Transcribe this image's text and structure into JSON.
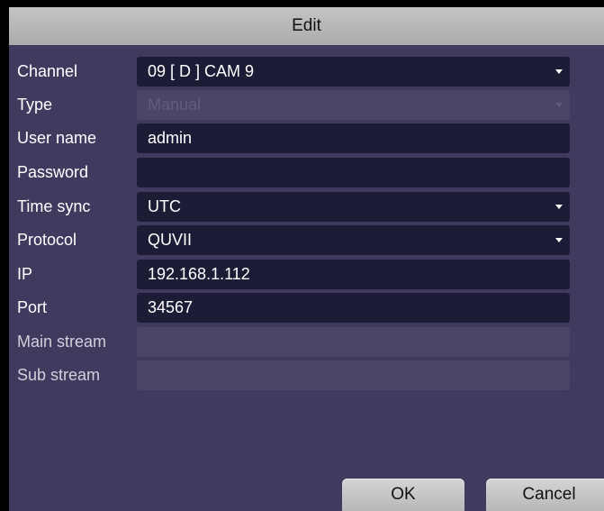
{
  "dialog": {
    "title": "Edit"
  },
  "fields": {
    "channel": {
      "label": "Channel",
      "value": "09 [ D ] CAM 9"
    },
    "type": {
      "label": "Type",
      "value": "Manual"
    },
    "user_name": {
      "label": "User name",
      "value": "admin"
    },
    "password": {
      "label": "Password",
      "value": ""
    },
    "time_sync": {
      "label": "Time sync",
      "value": "UTC"
    },
    "protocol": {
      "label": "Protocol",
      "value": "QUVII"
    },
    "ip": {
      "label": "IP",
      "value": "192.168.1.112"
    },
    "port": {
      "label": "Port",
      "value": "34567"
    },
    "main_stream": {
      "label": "Main stream",
      "value": ""
    },
    "sub_stream": {
      "label": "Sub stream",
      "value": ""
    }
  },
  "buttons": {
    "ok": "OK",
    "cancel": "Cancel"
  },
  "colors": {
    "dialog_bg": "#3f3a5e",
    "field_bg": "#1d1c36",
    "disabled_field_bg": "#4a4668",
    "titlebar_bg": "#bdbdbd"
  },
  "icons": {
    "dropdown": "caret-down-icon"
  }
}
